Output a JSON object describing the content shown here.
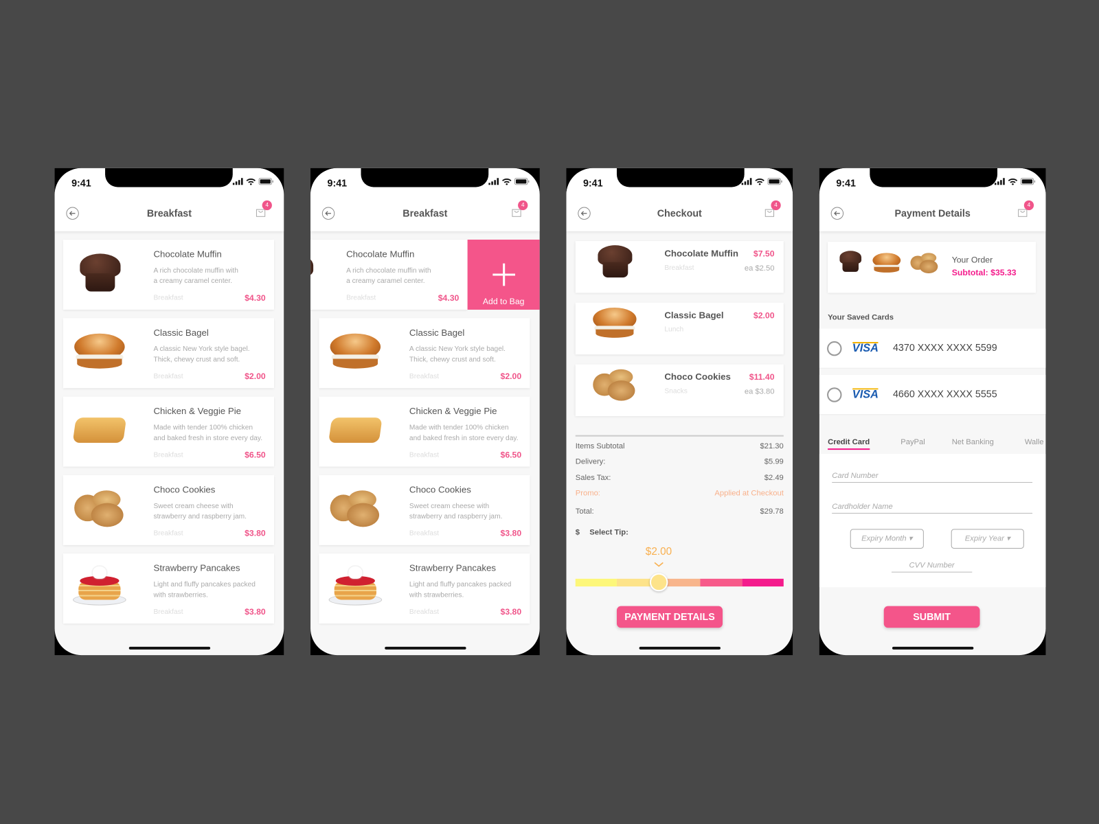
{
  "status_time": "9:41",
  "colors": {
    "accent": "#f4558a",
    "background": "#484848",
    "promo": "#f8b08a",
    "tip": "#f8b050"
  },
  "menu": {
    "title": "Breakfast",
    "cart_count": "4",
    "items": [
      {
        "name": "Chocolate Muffin",
        "desc1": "A rich chocolate muffin with",
        "desc2": "a creamy caramel center.",
        "category": "Breakfast",
        "price": "$4.30",
        "food": "muffin"
      },
      {
        "name": "Classic Bagel",
        "desc1": "A classic New York style bagel.",
        "desc2": "Thick, chewy crust and soft.",
        "category": "Breakfast",
        "price": "$2.00",
        "food": "bagel"
      },
      {
        "name": "Chicken & Veggie Pie",
        "desc1": "Made with tender 100% chicken",
        "desc2": "and baked fresh in store every day.",
        "category": "Breakfast",
        "price": "$6.50",
        "food": "pie"
      },
      {
        "name": "Choco Cookies",
        "desc1": "Sweet cream cheese with",
        "desc2": "strawberry and raspberry jam.",
        "category": "Breakfast",
        "price": "$3.80",
        "food": "cookies"
      },
      {
        "name": "Strawberry Pancakes",
        "desc1": "Light and fluffy pancakes packed",
        "desc2": "with strawberries.",
        "category": "Breakfast",
        "price": "$3.80",
        "food": "pancakes"
      }
    ],
    "add_to_bag": "Add to Bag"
  },
  "checkout": {
    "title": "Checkout",
    "cart_count": "4",
    "items": [
      {
        "name": "Chocolate Muffin",
        "category": "Breakfast",
        "total": "$7.50",
        "each": "ea $2.50",
        "food": "muffin"
      },
      {
        "name": "Classic Bagel",
        "category": "Lunch",
        "total": "$2.00",
        "each": "",
        "food": "bagel"
      },
      {
        "name": "Choco Cookies",
        "category": "Snacks",
        "total": "$11.40",
        "each": "ea $3.80",
        "food": "cookies"
      }
    ],
    "summary": [
      {
        "label": "Items Subtotal",
        "value": "$21.30"
      },
      {
        "label": "Delivery:",
        "value": "$5.99"
      },
      {
        "label": "Sales Tax:",
        "value": "$2.49"
      },
      {
        "label": "Promo:",
        "value": "Applied at Checkout"
      },
      {
        "label": "Total:",
        "value": "$29.78"
      }
    ],
    "tip_currency": "$",
    "tip_label": "Select Tip:",
    "tip_value": "$2.00",
    "tip_position_percent": 40,
    "button": "PAYMENT DETAILS"
  },
  "payment": {
    "title": "Payment Details",
    "cart_count": "4",
    "order_label": "Your Order",
    "subtotal": "Subtotal: $35.33",
    "saved_cards_label": "Your Saved Cards",
    "cards": [
      {
        "brand": "VISA",
        "number": "4370 XXXX XXXX 5599"
      },
      {
        "brand": "VISA",
        "number": "4660 XXXX XXXX 5555"
      }
    ],
    "tabs": [
      "Credit Card",
      "PayPal",
      "Net Banking",
      "Walle"
    ],
    "active_tab": "Credit Card",
    "card_number_placeholder": "Card Number",
    "cardholder_placeholder": "Cardholder Name",
    "expiry_month": "Expiry Month",
    "expiry_year": "Expiry Year",
    "cvv_placeholder": "CVV Number",
    "submit": "SUBMIT"
  }
}
